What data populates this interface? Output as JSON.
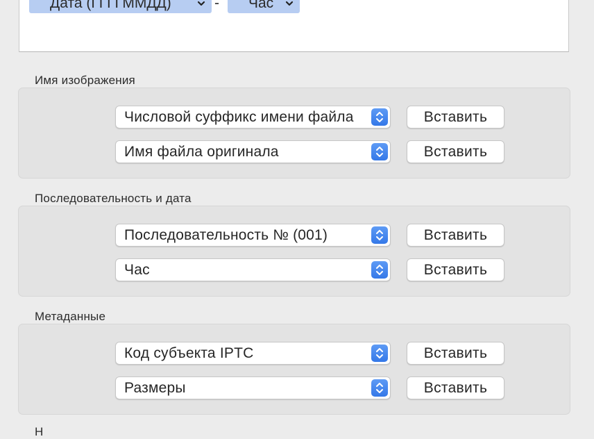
{
  "token_editor": {
    "tokens": [
      {
        "label": "Дата (ГГГГММДД)"
      },
      {
        "label": "Час"
      }
    ],
    "separator": "-"
  },
  "sections": [
    {
      "title": "Имя изображения",
      "rows": [
        {
          "popup": "Числовой суффикс имени файла",
          "button": "Вставить"
        },
        {
          "popup": "Имя файла оригинала",
          "button": "Вставить"
        }
      ]
    },
    {
      "title": "Последовательность и дата",
      "rows": [
        {
          "popup": "Последовательность № (001)",
          "button": "Вставить"
        },
        {
          "popup": "Час",
          "button": "Вставить"
        }
      ]
    },
    {
      "title": "Метаданные",
      "rows": [
        {
          "popup": "Код субъекта IPTC",
          "button": "Вставить"
        },
        {
          "popup": "Размеры",
          "button": "Вставить"
        }
      ]
    }
  ],
  "next_section_partial": "Н",
  "colors": {
    "token_bg": "#b7cdf2",
    "stepper_blue": "#3478e8",
    "group_bg": "#e3e3e3",
    "window_bg": "#ececec"
  }
}
